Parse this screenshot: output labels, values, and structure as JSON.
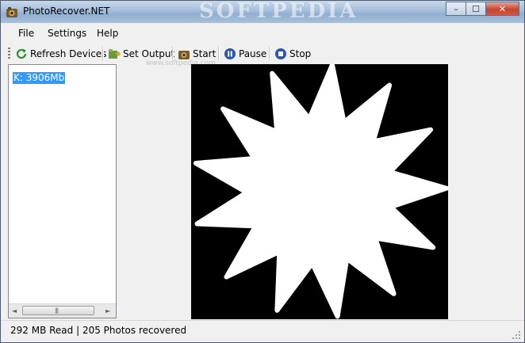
{
  "window": {
    "title": "PhotoRecover.NET",
    "watermark": "SOFTPEDIA"
  },
  "titlebar_buttons": {
    "minimize": "–",
    "maximize": "☐",
    "close": "✕"
  },
  "menu": {
    "items": [
      "File",
      "Settings",
      "Help"
    ]
  },
  "toolbar": {
    "refresh_label": "Refresh Devices",
    "set_output_label": "Set Output",
    "start_label": "Start",
    "pause_label": "Pause",
    "stop_label": "Stop",
    "watermark": "www.softpedia.com"
  },
  "devices": {
    "items": [
      "K: 3906Mb"
    ],
    "selected_index": 0
  },
  "scrollbar": {
    "left_arrow": "◄",
    "right_arrow": "►",
    "thumb_grip": "|||"
  },
  "status": {
    "text": "292 MB Read | 205 Photos recovered"
  },
  "colors": {
    "selection": "#3399ff",
    "preview_bg": "#000000",
    "titlebar": "#a9c1dc"
  }
}
